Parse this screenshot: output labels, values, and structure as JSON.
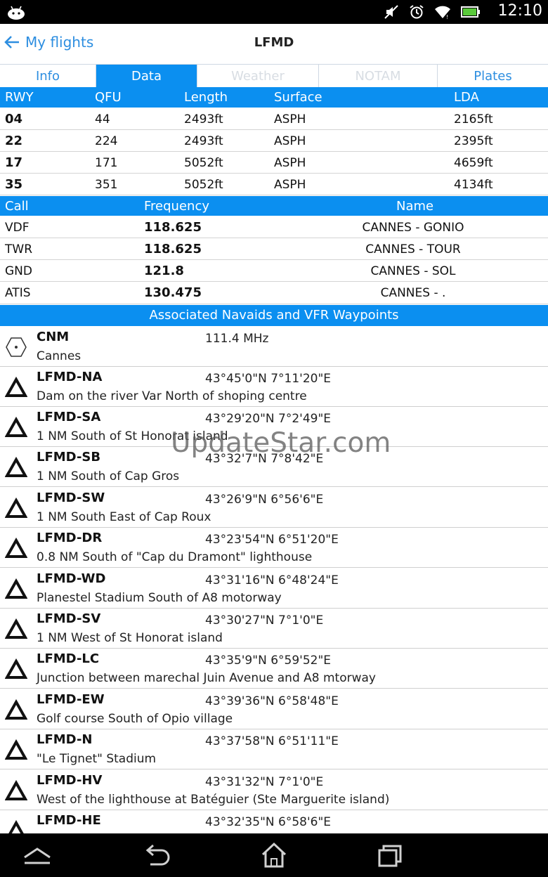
{
  "status": {
    "time": "12:10"
  },
  "header": {
    "back_label": "My flights",
    "title": "LFMD"
  },
  "tabs": [
    {
      "label": "Info",
      "state": "normal"
    },
    {
      "label": "Data",
      "state": "active"
    },
    {
      "label": "Weather",
      "state": "disabled"
    },
    {
      "label": "NOTAM",
      "state": "disabled"
    },
    {
      "label": "Plates",
      "state": "normal"
    }
  ],
  "runways": {
    "headers": [
      "RWY",
      "QFU",
      "Length",
      "Surface",
      "LDA"
    ],
    "rows": [
      [
        "04",
        "44",
        "2493ft",
        "ASPH",
        "2165ft"
      ],
      [
        "22",
        "224",
        "2493ft",
        "ASPH",
        "2395ft"
      ],
      [
        "17",
        "171",
        "5052ft",
        "ASPH",
        "4659ft"
      ],
      [
        "35",
        "351",
        "5052ft",
        "ASPH",
        "4134ft"
      ]
    ]
  },
  "frequencies": {
    "headers": [
      "Call",
      "Frequency",
      "Name"
    ],
    "rows": [
      [
        "VDF",
        "118.625",
        "CANNES - GONIO"
      ],
      [
        "TWR",
        "118.625",
        "CANNES - TOUR"
      ],
      [
        "GND",
        "121.8",
        "CANNES - SOL"
      ],
      [
        "ATIS",
        "130.475",
        "CANNES - ."
      ]
    ]
  },
  "navaids": {
    "header": "Associated Navaids and VFR Waypoints",
    "items": [
      {
        "id": "CNM",
        "desc": "Cannes",
        "info": "111.4 MHz",
        "icon": "vor-icon"
      },
      {
        "id": "LFMD-NA",
        "desc": "Dam on the river Var North of shoping centre",
        "info": "43°45'0\"N 7°11'20\"E",
        "icon": "waypoint-icon"
      },
      {
        "id": "LFMD-SA",
        "desc": "1 NM South of St Honorat island",
        "info": "43°29'20\"N 7°2'49\"E",
        "icon": "waypoint-icon"
      },
      {
        "id": "LFMD-SB",
        "desc": "1 NM South of Cap Gros",
        "info": "43°32'7\"N 7°8'42\"E",
        "icon": "waypoint-icon"
      },
      {
        "id": "LFMD-SW",
        "desc": "1 NM South East of Cap Roux",
        "info": "43°26'9\"N 6°56'6\"E",
        "icon": "waypoint-icon"
      },
      {
        "id": "LFMD-DR",
        "desc": "0.8 NM South of \"Cap du Dramont\" lighthouse",
        "info": "43°23'54\"N 6°51'20\"E",
        "icon": "waypoint-icon"
      },
      {
        "id": "LFMD-WD",
        "desc": "Planestel Stadium South of A8 motorway",
        "info": "43°31'16\"N 6°48'24\"E",
        "icon": "waypoint-icon"
      },
      {
        "id": "LFMD-SV",
        "desc": "1 NM West of St Honorat island",
        "info": "43°30'27\"N 7°1'0\"E",
        "icon": "waypoint-icon"
      },
      {
        "id": "LFMD-LC",
        "desc": "Junction between marechal Juin Avenue and A8 mtorway",
        "info": "43°35'9\"N 6°59'52\"E",
        "icon": "waypoint-icon"
      },
      {
        "id": "LFMD-EW",
        "desc": "Golf course South of Opio village",
        "info": "43°39'36\"N 6°58'48\"E",
        "icon": "waypoint-icon"
      },
      {
        "id": "LFMD-N",
        "desc": "\"Le Tignet\" Stadium",
        "info": "43°37'58\"N 6°51'11\"E",
        "icon": "waypoint-icon"
      },
      {
        "id": "LFMD-HV",
        "desc": "West of the lighthouse at Batéguier (Ste Marguerite island)",
        "info": "43°31'32\"N 7°1'0\"E",
        "icon": "waypoint-icon"
      },
      {
        "id": "LFMD-HE",
        "desc": "",
        "info": "43°32'35\"N 6°58'6\"E",
        "icon": "waypoint-icon"
      }
    ]
  },
  "watermark": "UpdateStar.com",
  "colors": {
    "accent": "#0b8ff0",
    "link": "#2d8ee0"
  }
}
